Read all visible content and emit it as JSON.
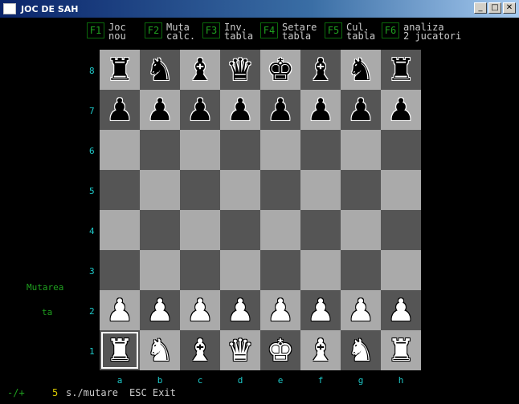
{
  "window": {
    "title": "JOC DE SAH",
    "min": "_",
    "max": "□",
    "close": "✕"
  },
  "menu": [
    {
      "key": "F1",
      "line1": "Joc",
      "line2": "nou"
    },
    {
      "key": "F2",
      "line1": "Muta",
      "line2": "calc."
    },
    {
      "key": "F3",
      "line1": "Inv.",
      "line2": "tabla"
    },
    {
      "key": "F4",
      "line1": "Setare",
      "line2": "tabla"
    },
    {
      "key": "F5",
      "line1": "Cul.",
      "line2": "tabla"
    },
    {
      "key": "F6",
      "line1": "analiza",
      "line2": "2 jucatori"
    }
  ],
  "board": {
    "rows": [
      [
        "♜",
        "♞",
        "♝",
        "♛",
        "♚",
        "♝",
        "♞",
        "♜"
      ],
      [
        "♟",
        "♟",
        "♟",
        "♟",
        "♟",
        "♟",
        "♟",
        "♟"
      ],
      [
        "",
        "",
        "",
        "",
        "",
        "",
        "",
        ""
      ],
      [
        "",
        "",
        "",
        "",
        "",
        "",
        "",
        ""
      ],
      [
        "",
        "",
        "",
        "",
        "",
        "",
        "",
        ""
      ],
      [
        "",
        "",
        "",
        "",
        "",
        "",
        "",
        ""
      ],
      [
        "♟",
        "♟",
        "♟",
        "♟",
        "♟",
        "♟",
        "♟",
        "♟"
      ],
      [
        "♜",
        "♞",
        "♝",
        "♛",
        "♚",
        "♝",
        "♞",
        "♜"
      ]
    ],
    "colors": [
      "b",
      "b",
      "e",
      "e",
      "e",
      "e",
      "w",
      "w"
    ],
    "selected": "a1",
    "light_color": "#aaaaaa",
    "dark_color": "#555555",
    "ranks": [
      "8",
      "7",
      "6",
      "5",
      "4",
      "3",
      "2",
      "1"
    ],
    "files": [
      "a",
      "b",
      "c",
      "d",
      "e",
      "f",
      "g",
      "h"
    ]
  },
  "turn": {
    "line1": "Mutarea",
    "line2": "ta"
  },
  "status": {
    "plusminus": "-/+",
    "seconds": "5",
    "per_move": "s./mutare",
    "esc": "ESC Exit"
  }
}
